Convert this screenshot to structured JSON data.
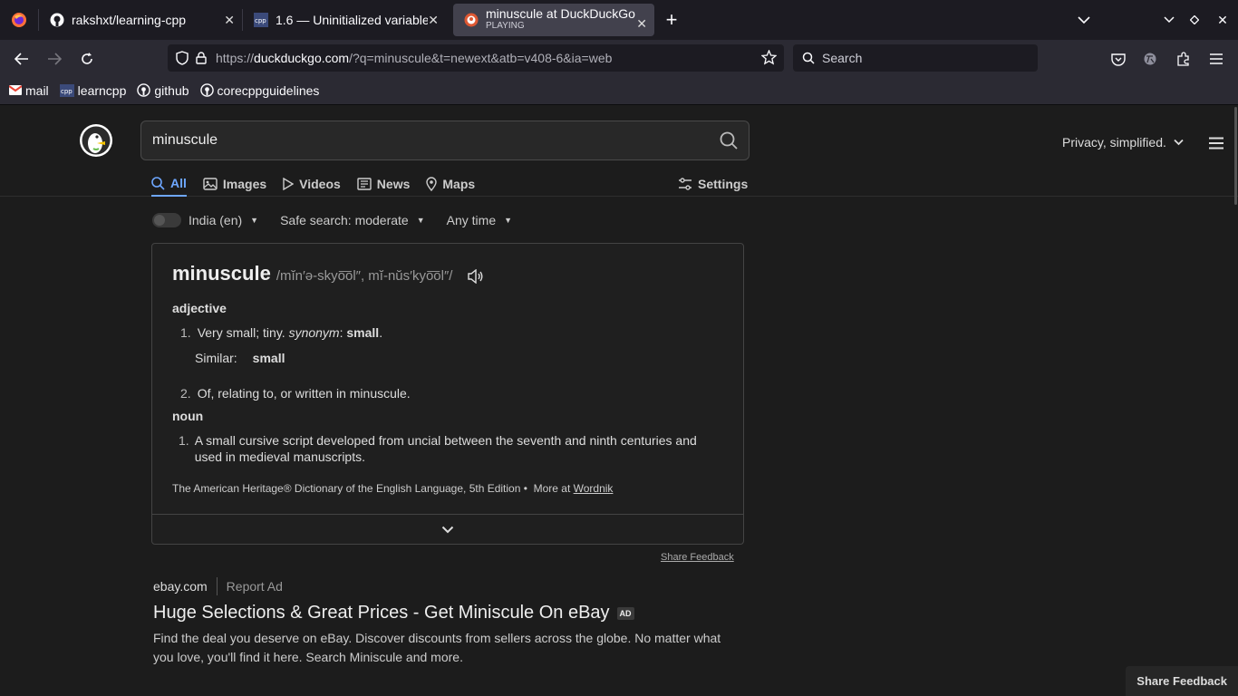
{
  "browser": {
    "tabs": [
      {
        "title": "rakshxt/learning-cpp",
        "subtitle": ""
      },
      {
        "title": "1.6 — Uninitialized variable",
        "subtitle": ""
      },
      {
        "title": "minuscule at DuckDuckGo",
        "subtitle": "PLAYING"
      }
    ],
    "url_prefix": "https://",
    "url_domain": "duckduckgo.com",
    "url_rest": "/?q=minuscule&t=newext&atb=v408-6&ia=web",
    "search_placeholder": "Search",
    "bookmarks": [
      "mail",
      "learncpp",
      "github",
      "corecppguidelines"
    ]
  },
  "ddg": {
    "query": "minuscule",
    "tagline": "Privacy, simplified.",
    "tabs": [
      "All",
      "Images",
      "Videos",
      "News",
      "Maps"
    ],
    "settings": "Settings",
    "filters": {
      "region": "India (en)",
      "safe": "Safe search: moderate",
      "time": "Any time"
    },
    "definition": {
      "word": "minuscule",
      "pron": "/mĭn′ə-skyo͞ol″, mĭ-nŭs′kyo͞ol″/",
      "pos1": "adjective",
      "def1_num": "1.",
      "def1_text": "Very small; tiny.",
      "def1_syn_label": "synonym",
      "def1_syn": "small",
      "similar_label": "Similar:",
      "similar_word": "small",
      "def2_num": "2.",
      "def2_text": "Of, relating to, or written in minuscule.",
      "pos2": "noun",
      "def3_num": "1.",
      "def3_text": "A small cursive script developed from uncial between the seventh and ninth centuries and used in medieval manuscripts.",
      "source": "The American Heritage® Dictionary of the English Language, 5th Edition •",
      "more_at": "More at",
      "more_link": "Wordnik"
    },
    "share_feedback": "Share Feedback",
    "ad": {
      "domain": "ebay.com",
      "report": "Report Ad",
      "title": "Huge Selections & Great Prices - Get Miniscule On eBay",
      "badge": "AD",
      "desc": "Find the deal you deserve on eBay. Discover discounts from sellers across the globe. No matter what you love, you'll find it here. Search Miniscule and more."
    },
    "share_feedback_bottom": "Share Feedback"
  }
}
